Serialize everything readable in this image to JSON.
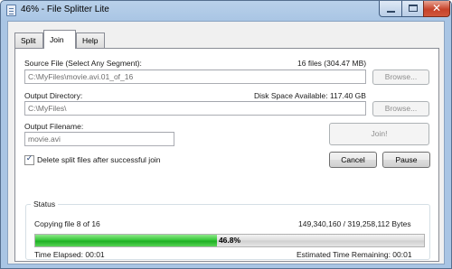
{
  "window": {
    "title": "46% - File Splitter Lite"
  },
  "tabs": [
    {
      "label": "Split"
    },
    {
      "label": "Join",
      "active": true
    },
    {
      "label": "Help"
    }
  ],
  "source": {
    "label": "Source File (Select Any Segment):",
    "info": "16 files (304.47 MB)",
    "value": "C:\\MyFiles\\movie.avi.01_of_16",
    "browse": "Browse..."
  },
  "output_dir": {
    "label": "Output Directory:",
    "info": "Disk Space Available: 117.40 GB",
    "value": "C:\\MyFiles\\",
    "browse": "Browse..."
  },
  "output_filename": {
    "label": "Output Filename:",
    "value": "movie.avi"
  },
  "join_button": "Join!",
  "delete_option": {
    "label": "Delete split files after successful join",
    "checked": true
  },
  "cancel_button": "Cancel",
  "pause_button": "Pause",
  "status": {
    "title": "Status",
    "copying": "Copying file 8 of 16",
    "bytes": "149,340,160 / 319,258,112 Bytes",
    "progress_label": "46.8%",
    "progress": 0.468,
    "elapsed": "Time Elapsed: 00:01",
    "remaining": "Estimated Time Remaining: 00:01"
  },
  "colors": {
    "progress_fill": "#2cbf30",
    "close_button": "#c7432a",
    "title_bar": "#b9d1ea"
  },
  "icons": {
    "app": "file-splitter-icon",
    "min": "minimize-icon",
    "max": "maximize-icon",
    "close": "close-icon",
    "check": "checkmark-icon"
  }
}
